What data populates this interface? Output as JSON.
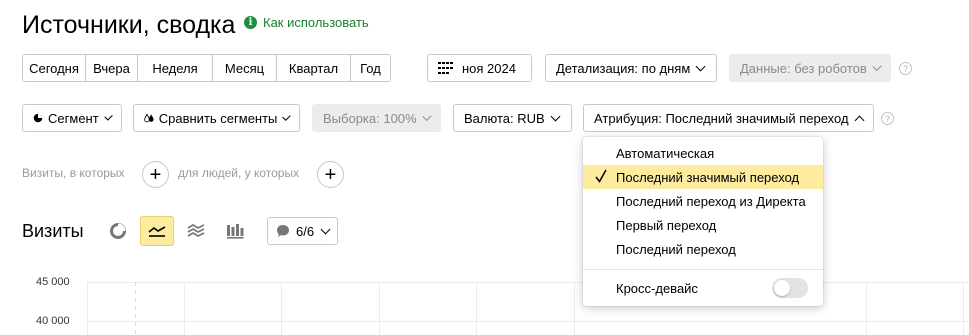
{
  "header": {
    "title": "Источники, сводка",
    "howto_label": "Как использовать"
  },
  "period": {
    "items": [
      "Сегодня",
      "Вчера",
      "Неделя",
      "Месяц",
      "Квартал",
      "Год"
    ]
  },
  "date_label": "ноя 2024",
  "detail_label": "Детализация: по дням",
  "data_label": "Данные: без роботов",
  "toolbar": {
    "segment_label": "Сегмент",
    "compare_label": "Сравнить сегменты",
    "sample_label": "Выборка: 100%",
    "currency_label": "Валюта: RUB",
    "attribution_label": "Атрибуция: Последний значимый переход"
  },
  "conditions": {
    "visits_label": "Визиты, в которых",
    "people_label": "для людей, у которых"
  },
  "chart": {
    "heading": "Визиты",
    "counter": "6/6",
    "y_ticks": [
      "45 000",
      "40 000"
    ]
  },
  "attribution_menu": {
    "items": [
      "Автоматическая",
      "Последний значимый переход",
      "Последний переход из Директа",
      "Первый переход",
      "Последний переход"
    ],
    "selected": "Последний значимый переход",
    "cross_device_label": "Кросс-девайс",
    "cross_device_enabled": false
  },
  "colors": {
    "accent_yellow": "#fdeba0",
    "help_green": "#1f8f3a"
  }
}
